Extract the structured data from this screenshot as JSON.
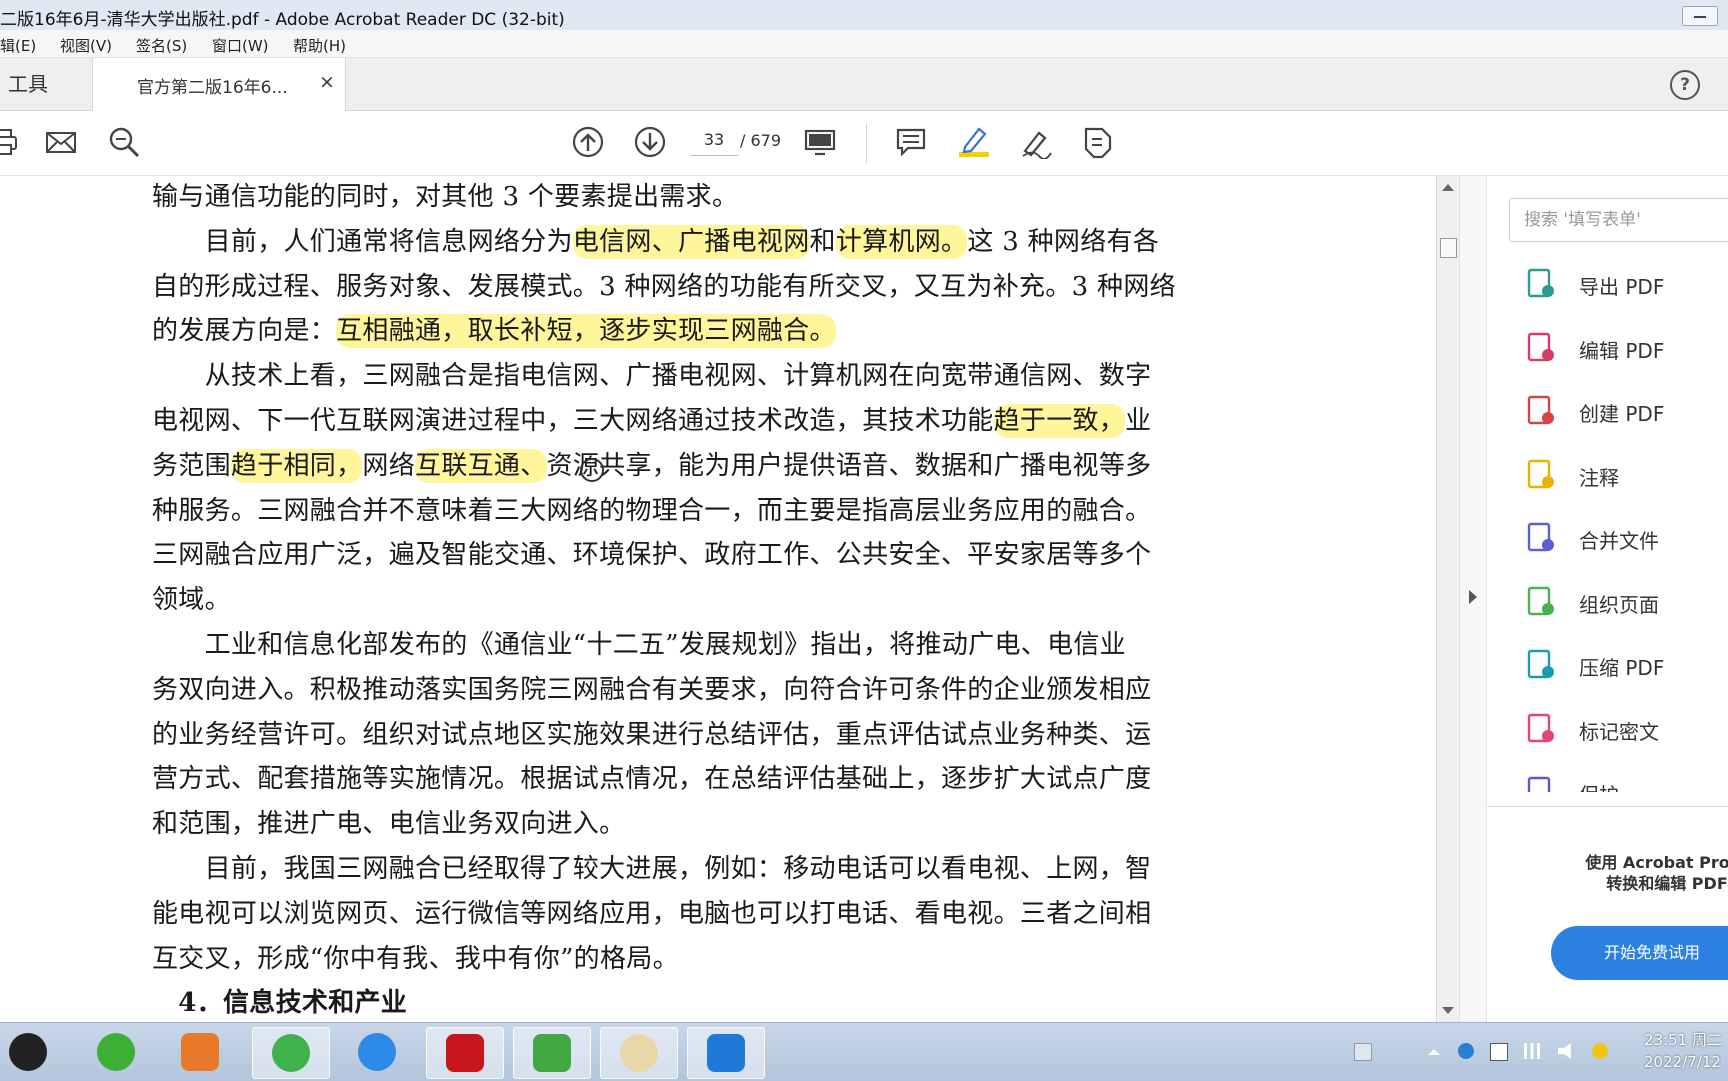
{
  "window": {
    "title": "二版16年6月-清华大学出版社.pdf - Adobe Acrobat Reader DC (32-bit)"
  },
  "menu": [
    "辑(E)",
    "视图(V)",
    "签名(S)",
    "窗口(W)",
    "帮助(H)"
  ],
  "tabs": {
    "tools": "工具",
    "doc": "官方第二版16年6...",
    "close": "×"
  },
  "help": "?",
  "toolbar": {
    "page_current": "33",
    "page_total": "/ 679"
  },
  "doc": {
    "lines": [
      [
        "输与通信功能的同时，对其他 3 个要素提出需求。"
      ],
      [
        "　　目前，人们通常将信息网络分为",
        {
          "hl": "电信网、广播电视网"
        },
        "和",
        {
          "hl": "计算机网。"
        },
        "这 3 种网络有各"
      ],
      [
        "自的形成过程、服务对象、发展模式。3 种网络的功能有所交叉，又互为补充。3 种网络"
      ],
      [
        "的发展方向是：",
        {
          "hl": "互相融通，取长补短，逐步实现三网融合。"
        }
      ],
      [
        "　　从技术上看，三网融合是指电信网、广播电视网、计算机网在向宽带通信网、数字"
      ],
      [
        "电视网、下一代互联网演进过程中，三大网络通过技术改造，其技术功能",
        {
          "hl": "趋于一致，"
        },
        "业"
      ],
      [
        "务范围",
        {
          "hl": "趋于相同，"
        },
        "网络",
        {
          "hl": "互联互通、"
        },
        "资源共享，能为用户提供语音、数据和广播电视等多"
      ],
      [
        "种服务。三网融合并不意味着三大网络的物理合一，而主要是指高层业务应用的融合。"
      ],
      [
        "三网融合应用广泛，遍及智能交通、环境保护、政府工作、公共安全、平安家居等多个"
      ],
      [
        "领域。"
      ],
      [
        "　　工业和信息化部发布的《通信业“十二五”发展规划》指出，将推动广电、电信业"
      ],
      [
        "务双向进入。积极推动落实国务院三网融合有关要求，向符合许可条件的企业颁发相应"
      ],
      [
        "的业务经营许可。组织对试点地区实施效果进行总结评估，重点评估试点业务种类、运"
      ],
      [
        "营方式、配套措施等实施情况。根据试点情况，在总结评估基础上，逐步扩大试点广度"
      ],
      [
        "和范围，推进广电、电信业务双向进入。"
      ],
      [
        "　　目前，我国三网融合已经取得了较大进展，例如：移动电话可以看电视、上网，智"
      ],
      [
        "能电视可以浏览网页、运行微信等网络应用，电脑也可以打电话、看电视。三者之间相"
      ],
      [
        "互交叉，形成“你中有我、我中有你”的格局。"
      ],
      [
        "　4．信息技术和产业"
      ]
    ]
  },
  "rightpane": {
    "search_placeholder": "搜索 '填写表单'",
    "tools": [
      {
        "label": "导出 PDF",
        "icon": "export-pdf-icon",
        "color": "#2a9d8f"
      },
      {
        "label": "编辑 PDF",
        "icon": "edit-pdf-icon",
        "color": "#d63e6a"
      },
      {
        "label": "创建 PDF",
        "icon": "create-pdf-icon",
        "color": "#d64545"
      },
      {
        "label": "注释",
        "icon": "comment-icon",
        "color": "#e8b400"
      },
      {
        "label": "合并文件",
        "icon": "combine-files-icon",
        "color": "#5b5fd6"
      },
      {
        "label": "组织页面",
        "icon": "organize-pages-icon",
        "color": "#4caf50"
      },
      {
        "label": "压缩 PDF",
        "icon": "compress-pdf-icon",
        "color": "#1a9bb0"
      },
      {
        "label": "标记密文",
        "icon": "redact-icon",
        "color": "#e0457b"
      },
      {
        "label": "保护",
        "icon": "protect-icon",
        "color": "#6a4fd0"
      }
    ],
    "promo": [
      "使用 Acrobat Pro D",
      "转换和编辑 PDF"
    ],
    "trial_button": "开始免费试用"
  },
  "taskbar": {
    "time": "23:51 周二",
    "date": "2022/7/12"
  },
  "colors": {
    "highlight": "#fff59a",
    "accent": "#2c80e0"
  }
}
